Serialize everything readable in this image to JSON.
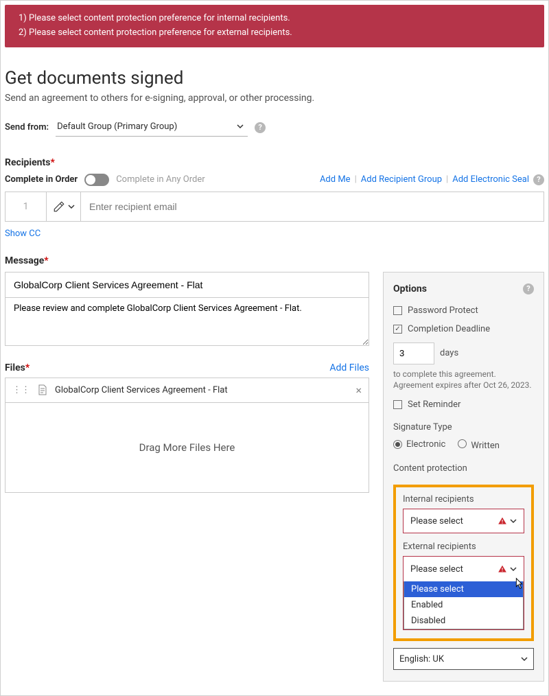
{
  "alert": {
    "line1": "1) Please select content protection preference for internal recipients.",
    "line2": "2) Please select content protection preference for external recipients."
  },
  "header": {
    "title": "Get documents signed",
    "subtitle": "Send an agreement to others for e-signing, approval, or other processing."
  },
  "send_from": {
    "label": "Send from:",
    "value": "Default Group (Primary Group)"
  },
  "recipients": {
    "label": "Recipients",
    "complete_in_order": "Complete in Order",
    "complete_any_order": "Complete in Any Order",
    "add_me": "Add Me",
    "add_group": "Add Recipient Group",
    "add_seal": "Add Electronic Seal",
    "num": "1",
    "placeholder": "Enter recipient email",
    "show_cc": "Show CC"
  },
  "message": {
    "label": "Message",
    "subject": "GlobalCorp Client Services Agreement - Flat",
    "body": "Please review and complete GlobalCorp Client Services Agreement - Flat."
  },
  "files": {
    "label": "Files",
    "add_files": "Add Files",
    "item": "GlobalCorp Client Services Agreement - Flat",
    "drop_text": "Drag More Files Here"
  },
  "options": {
    "title": "Options",
    "password_protect": "Password Protect",
    "completion_deadline": "Completion Deadline",
    "days_value": "3",
    "days_label": "days",
    "note1": "to complete this agreement.",
    "note2": "Agreement expires after Oct 26, 2023.",
    "set_reminder": "Set Reminder",
    "signature_type": "Signature Type",
    "electronic": "Electronic",
    "written": "Written"
  },
  "content_protection": {
    "title": "Content protection",
    "internal_label": "Internal recipients",
    "internal_value": "Please select",
    "external_label": "External recipients",
    "external_value": "Please select",
    "opt_please_select": "Please select",
    "opt_enabled": "Enabled",
    "opt_disabled": "Disabled"
  },
  "language": {
    "value": "English: UK"
  }
}
